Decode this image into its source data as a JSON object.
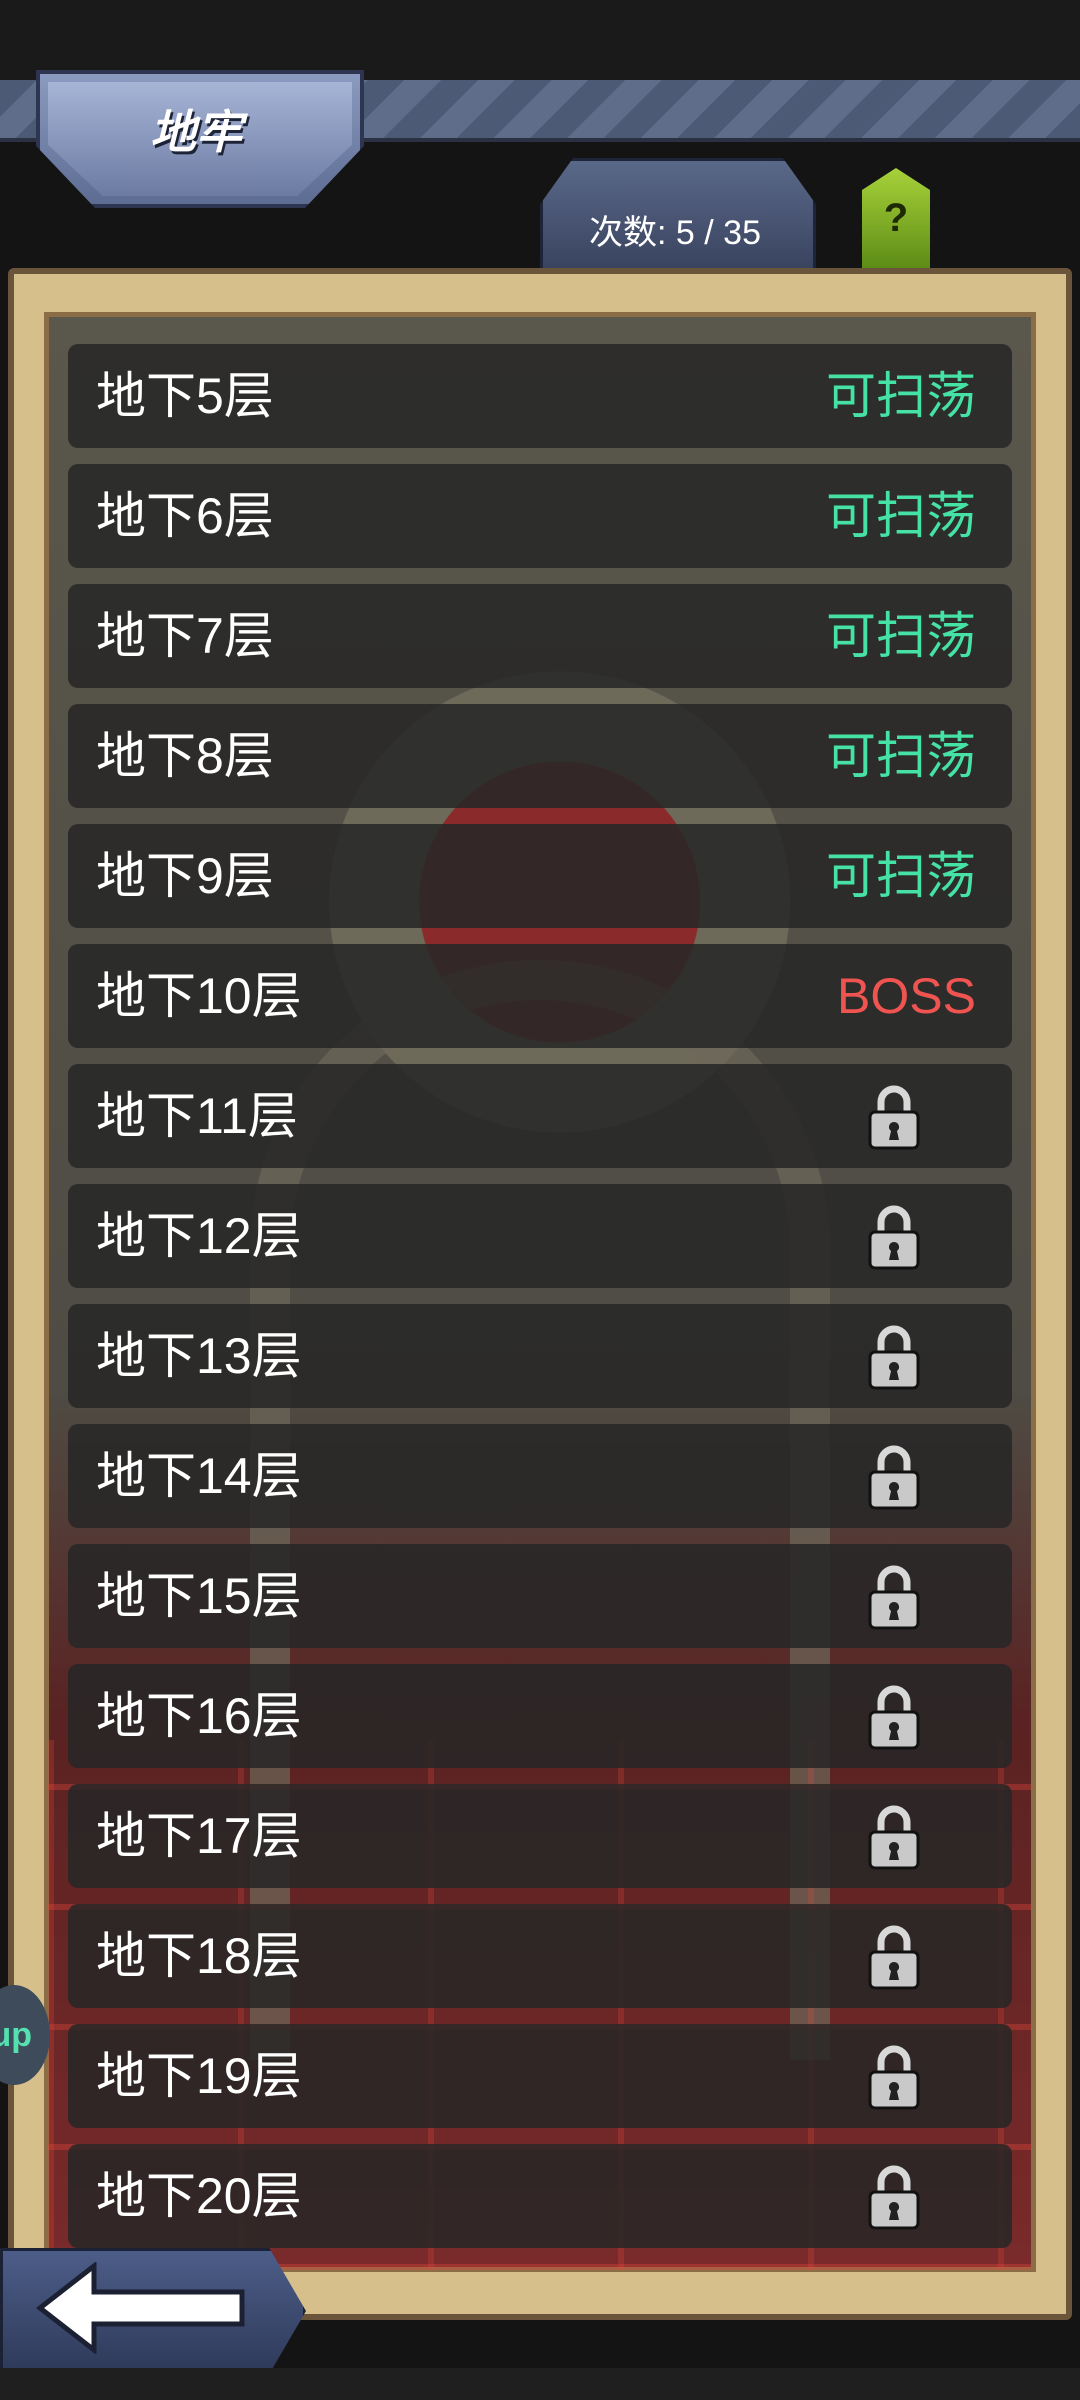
{
  "header": {
    "title": "地牢",
    "attempts_label": "次数: 5 / 35",
    "help_label": "?"
  },
  "floors": [
    {
      "label": "地下5层",
      "status": "可扫荡",
      "state": "sweepable"
    },
    {
      "label": "地下6层",
      "status": "可扫荡",
      "state": "sweepable"
    },
    {
      "label": "地下7层",
      "status": "可扫荡",
      "state": "sweepable"
    },
    {
      "label": "地下8层",
      "status": "可扫荡",
      "state": "sweepable"
    },
    {
      "label": "地下9层",
      "status": "可扫荡",
      "state": "sweepable"
    },
    {
      "label": "地下10层",
      "status": "BOSS",
      "state": "boss"
    },
    {
      "label": "地下11层",
      "status": "",
      "state": "locked",
      "icon": "lock-icon"
    },
    {
      "label": "地下12层",
      "status": "",
      "state": "locked",
      "icon": "lock-icon"
    },
    {
      "label": "地下13层",
      "status": "",
      "state": "locked",
      "icon": "lock-icon"
    },
    {
      "label": "地下14层",
      "status": "",
      "state": "locked",
      "icon": "lock-icon"
    },
    {
      "label": "地下15层",
      "status": "",
      "state": "locked",
      "icon": "lock-icon"
    },
    {
      "label": "地下16层",
      "status": "",
      "state": "locked",
      "icon": "lock-icon"
    },
    {
      "label": "地下17层",
      "status": "",
      "state": "locked",
      "icon": "lock-icon"
    },
    {
      "label": "地下18层",
      "status": "",
      "state": "locked",
      "icon": "lock-icon"
    },
    {
      "label": "地下19层",
      "status": "",
      "state": "locked",
      "icon": "lock-icon"
    },
    {
      "label": "地下20层",
      "status": "",
      "state": "locked",
      "icon": "lock-icon"
    }
  ],
  "side_bubble_label": "up",
  "colors": {
    "sweepable": "#46e2a5",
    "boss": "#ef5451",
    "row_bg": "#262626",
    "parchment": "#d7bf8c"
  },
  "footer": {
    "back_icon": "back-arrow-icon"
  }
}
